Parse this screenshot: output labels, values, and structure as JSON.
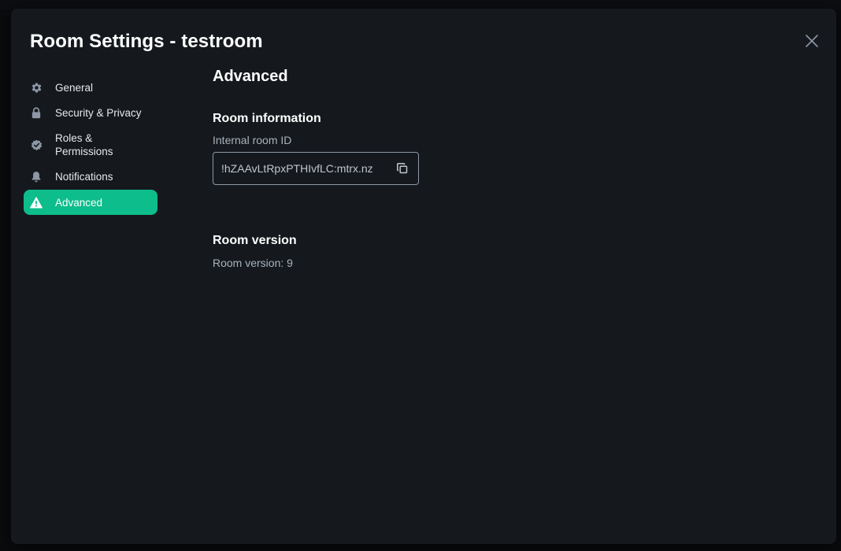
{
  "dialog": {
    "title": "Room Settings - testroom",
    "close_icon": "close-icon"
  },
  "sidebar": {
    "items": [
      {
        "label": "General",
        "icon": "gear-icon",
        "active": false
      },
      {
        "label": "Security & Privacy",
        "icon": "lock-icon",
        "active": false
      },
      {
        "label": "Roles & Permissions",
        "icon": "shield-check-icon",
        "active": false
      },
      {
        "label": "Notifications",
        "icon": "bell-icon",
        "active": false
      },
      {
        "label": "Advanced",
        "icon": "warning-icon",
        "active": true
      }
    ]
  },
  "content": {
    "section_title": "Advanced",
    "room_information": {
      "title": "Room information",
      "id_label": "Internal room ID",
      "id_value": "!hZAAvLtRpxPTHIvfLC:mtrx.nz",
      "copy_icon": "copy-icon"
    },
    "room_version": {
      "title": "Room version",
      "text": "Room version: 9"
    }
  },
  "colors": {
    "accent": "#0dbd8b",
    "dialog_bg": "#15191e",
    "text_primary": "#ffffff",
    "text_muted": "#a9b2bc"
  }
}
